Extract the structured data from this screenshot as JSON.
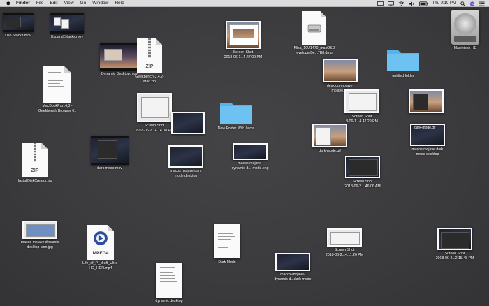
{
  "menubar": {
    "app_name": "Finder",
    "menus": [
      "File",
      "Edit",
      "View",
      "Go",
      "Window",
      "Help"
    ],
    "clock": "Thu 9:19 PM",
    "status_icons": [
      "screen-share-icon",
      "airplay-icon",
      "wifi-icon",
      "volume-icon",
      "battery-icon",
      "spotlight-icon",
      "siri-icon",
      "notification-center-icon"
    ]
  },
  "desktop": {
    "items": {
      "use_stacks": "Use Stacks.mov",
      "expand_stacks": "Expand Stacks.mov",
      "shot_top": "Screen Shot\n2018-06-1...4.47.09 PM",
      "misa": "Misa_10U1470_macOSD\neveloperBe...7B8.dmg",
      "macintosh_hd": "Macintosh HD",
      "dynamic_desktop": "Dynamic Desktop.mov",
      "geekbench": "Geekbench-3.4.2-\nMac.zip",
      "desktop_mojave": "desktop-mojave-\nmojave.jpg",
      "untitled_folder": "untitled folder",
      "macbookpro": "MacBookPro14,3 -\nGeekbench Browser 01",
      "new_folder": "New Folder With Items",
      "shot_top_right": "Screen Shot\n8-06-1...4.47.29 PM",
      "shot_mid": "Screen Shot\n2018-06-2...4.14.08 PM",
      "dark_mode_gif": "dark-mode.gif",
      "dark_mode_gif_right": "dark-mode.gif",
      "macos_mojave_dark_mode_desktop_right": "macos mojave dark\nmode desktop",
      "install_disk": "InstallDiskCreator.zip",
      "dark_mode_mov": "dark mode.mov",
      "macos_mojave_dark_mode_desktop": "macos mojave dark\nmode desktop",
      "macos_mojave_dynamic_mode": "macos-mojave-\ndynamic-d...-mode.png",
      "shot_ss1": "Screen Shot\n2018-06-2....46.06 AM",
      "macos_mojave_dynamic_icon": "macos mojave dynamic\ndesktop icon.jpg",
      "life_of_pi": "Life_of_Pi_draft_Ultra-\nHD_HDR.mp4",
      "dark_mode_doc": "Dark Mode",
      "shot_ss2": "Screen Shot\n2018-06-2...4.11.26 PM",
      "shot_ss3": "Screen Shot\n2018-06-2...2.15.45 PM",
      "macos_mojave_dark_mode_bottom": "macos-mojave-\ndynamic-d...dark-mode",
      "dynamic_desktop_bottom": "dynamic desktop"
    },
    "mpeg_badge": "MPEG4",
    "zip_badge": "ZIP"
  }
}
